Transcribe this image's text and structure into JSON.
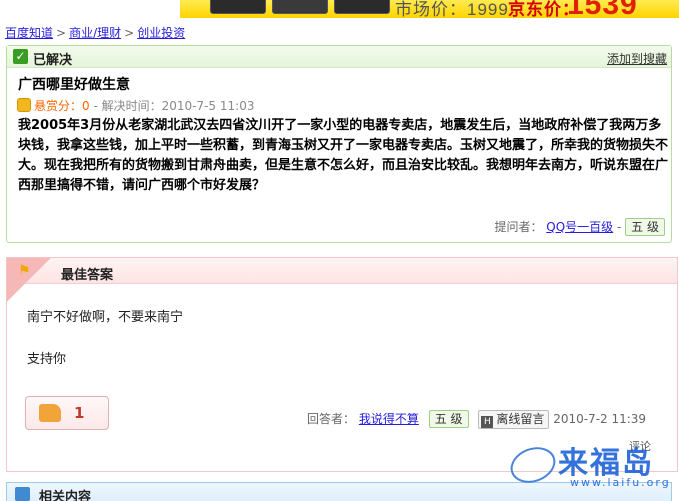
{
  "banner": {
    "market_price": "市场价：1999",
    "jd_label": "京东价：",
    "jd_price": "1539"
  },
  "breadcrumb": [
    "百度知道",
    "商业/理财",
    "创业投资"
  ],
  "question": {
    "status": "已解决",
    "add_favorite": "添加到搜藏",
    "title": "广西哪里好做生意",
    "bounty_label": "悬赏分：0",
    "solved_time": " - 解决时间：2010-7-5 11:03",
    "body": "我2005年3月份从老家湖北武汉去四省汶川开了一家小型的电器专卖店，地震发生后，当地政府补偿了我两万多块钱，我拿这些钱，加上平时一些积蓄，到青海玉树又开了一家电器专卖店。玉树又地震了，所幸我的货物损失不大。现在我把所有的货物搬到甘肃舟曲卖，但是生意不怎么好，而且治安比较乱。我想明年去南方，听说东盟在广西那里搞得不错，请问广西哪个市好发展？",
    "asker_label": "提问者：",
    "asker_name": "QQ号一百级",
    "asker_level": "五 级"
  },
  "best_answer": {
    "title": "最佳答案",
    "line1": "南宁不好做啊，不要来南宁",
    "line2": "支持你",
    "likes": "1",
    "answerer_label": "回答者：",
    "answerer_name": "我说得不算",
    "answerer_level": "五 级",
    "message_button": "离线留言",
    "time": "2010-7-2 11:39",
    "comment": "评论"
  },
  "related": {
    "title": "相关内容"
  },
  "watermark": {
    "text": "来福岛",
    "url": "www.laifu.org"
  },
  "colors": {
    "link": "#261cdc",
    "bounty": "#ff6600",
    "question_border": "#b7dba0",
    "answer_border": "#f3c7c7"
  }
}
